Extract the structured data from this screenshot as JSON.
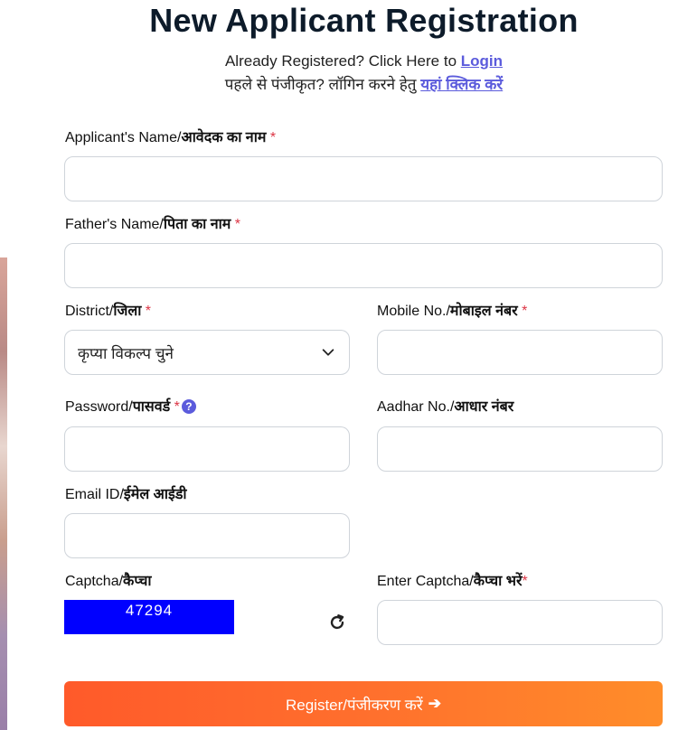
{
  "header": {
    "title": "New Applicant Registration",
    "already_text": "Already Registered? Click Here to ",
    "login_link": "Login",
    "hindi_text": "पहले से पंजीकृत? लॉगिन करने हेतु ",
    "hindi_link": "यहां क्लिक करें"
  },
  "form": {
    "applicant_name": {
      "label_en": "Applicant's Name/",
      "label_hi": "आवेदक का नाम",
      "required": "*",
      "value": ""
    },
    "father_name": {
      "label_en": "Father's Name/",
      "label_hi": "पिता का नाम",
      "required": "*",
      "value": ""
    },
    "district": {
      "label_en": "District/",
      "label_hi": "जिला",
      "required": "*",
      "selected": "कृप्या विकल्प चुने"
    },
    "mobile": {
      "label_en": "Mobile No./",
      "label_hi": "मोबाइल नंबर",
      "required": "*",
      "value": ""
    },
    "password": {
      "label_en": "Password/",
      "label_hi": "पासवर्ड",
      "required": "*",
      "help": "?",
      "value": ""
    },
    "aadhar": {
      "label_en": "Aadhar No./",
      "label_hi": "आधार नंबर",
      "value": ""
    },
    "email": {
      "label_en": "Email ID/",
      "label_hi": "ईमेल आईडी",
      "value": ""
    },
    "captcha": {
      "label_en": "Captcha/",
      "label_hi": "कैप्चा",
      "code": "47294"
    },
    "enter_captcha": {
      "label_en": "Enter Captcha/",
      "label_hi": "कैप्चा भरें",
      "required": "*",
      "value": ""
    },
    "register_label": "Register/पंजीकरण करें",
    "register_arrow": "➔"
  },
  "icons": {
    "help": "question-circle-icon",
    "chevron": "chevron-down-icon",
    "refresh": "refresh-icon",
    "arrow": "arrow-right-icon"
  },
  "colors": {
    "accent": "#5b5bdc",
    "required": "#dc3545",
    "captcha_bg": "#0000ff",
    "button_start": "#ff5a2a",
    "button_end": "#ff8d2a"
  }
}
